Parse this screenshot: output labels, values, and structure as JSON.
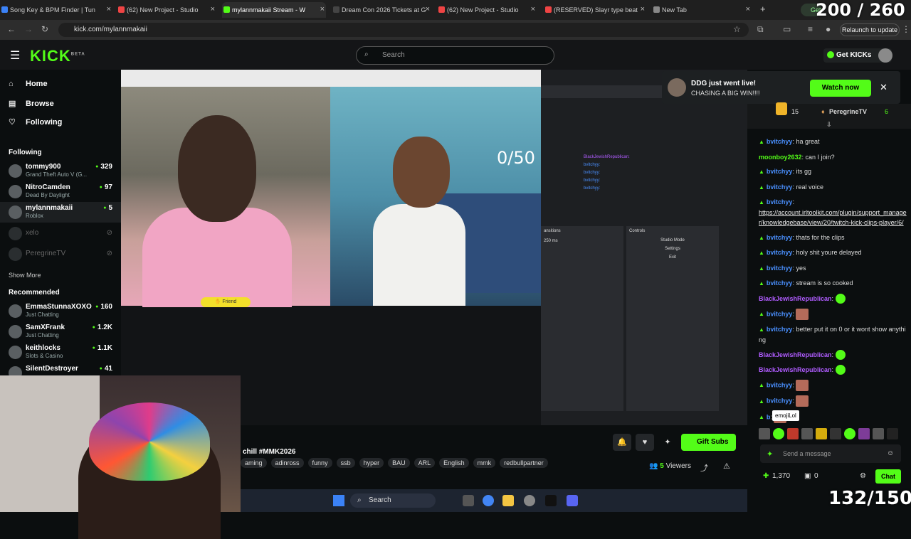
{
  "browser": {
    "tabs": [
      {
        "title": "Song Key & BPM Finder | Tun",
        "color": "#3b82f6"
      },
      {
        "title": "(62) New Project - Studio",
        "color": "#ef4444"
      },
      {
        "title": "mylannmakaii Stream - W",
        "color": "#53fc18",
        "active": true
      },
      {
        "title": "Dream Con 2026 Tickets at G",
        "color": "#444444"
      },
      {
        "title": "(62) New Project - Studio",
        "color": "#ef4444"
      },
      {
        "title": "(RESERVED) Slayr type beat",
        "color": "#ef4444"
      },
      {
        "title": "New Tab",
        "color": "#888888"
      }
    ],
    "url": "kick.com/mylannmakaii",
    "relaunch": "Relaunch to update",
    "getapp": "Get"
  },
  "overlay": {
    "top_counter": "200 / 260",
    "video_counter": "0/50",
    "bottom_counter": "132/150"
  },
  "header": {
    "logo": "KICK",
    "logo_sup": "BETA",
    "search_placeholder": "Search",
    "get_kicks": "Get KICKs"
  },
  "sidebar": {
    "nav": [
      {
        "label": "Home",
        "icon": "⌂"
      },
      {
        "label": "Browse",
        "icon": "▤"
      },
      {
        "label": "Following",
        "icon": "♡"
      }
    ],
    "following_title": "Following",
    "following": [
      {
        "name": "tommy900",
        "category": "Grand Theft Auto V (G...",
        "viewers": "329"
      },
      {
        "name": "NitroCamden",
        "category": "Dead By Daylight",
        "viewers": "97"
      },
      {
        "name": "mylannmakaii",
        "category": "Roblox",
        "viewers": "5",
        "selected": true
      },
      {
        "name": "xelo",
        "category": "",
        "viewers": "",
        "offline": true
      },
      {
        "name": "PeregrineTV",
        "category": "",
        "viewers": "",
        "offline": true
      }
    ],
    "show_more": "Show More",
    "recommended_title": "Recommended",
    "recommended": [
      {
        "name": "EmmaStunnaXOXO",
        "category": "Just Chatting",
        "viewers": "160"
      },
      {
        "name": "SamXFrank",
        "category": "Just Chatting",
        "viewers": "1.2K"
      },
      {
        "name": "keithlocks",
        "category": "Slots & Casino",
        "viewers": "1.1K"
      },
      {
        "name": "SilentDestroyer",
        "category": "",
        "viewers": "41"
      }
    ]
  },
  "notification": {
    "title": "DDG just went live!",
    "subtitle": "CHASING A BIG WIN!!!!",
    "watch": "Watch now"
  },
  "obs": {
    "chat": [
      "BlackJewishRepublican:",
      "bvitchyy:",
      "bvitchyy:",
      "bvitchyy:",
      "bvitchyy:"
    ],
    "transitions": "ansitions",
    "controls": "Controls",
    "studio_mode": "Studio Mode",
    "settings": "Settings",
    "exit": "Exit",
    "duration": "250 ms"
  },
  "stream_info": {
    "title": "chill #MMK2026",
    "tags": [
      "aming",
      "adinross",
      "funny",
      "ssb",
      "hyper",
      "BAU",
      "ARL",
      "English",
      "mmk",
      "redbullpartner"
    ],
    "gift_subs": "Gift Subs",
    "viewers_count": "5",
    "viewers_label": "Viewers"
  },
  "chat": {
    "gifter1": "PeregrineTV",
    "gifter1_count": "6",
    "gifter0_count": "15",
    "messages": [
      {
        "user": "bvitchyy",
        "color": "#4a90ff",
        "text": "ha great",
        "badge": true
      },
      {
        "user": "moonboy2632",
        "color": "#53fc18",
        "text": "can I join?"
      },
      {
        "user": "bvitchyy",
        "color": "#4a90ff",
        "text": "its gg",
        "badge": true
      },
      {
        "user": "bvitchyy",
        "color": "#4a90ff",
        "text": "real voice",
        "badge": true
      },
      {
        "user": "bvitchyy",
        "color": "#4a90ff",
        "text": "",
        "link": "https://account.irltoolkit.com/plugin/support_manager/knowledgebase/view/20/twitch-kick-clips-player/6/",
        "badge": true
      },
      {
        "user": "bvitchyy",
        "color": "#4a90ff",
        "text": "thats for the clips",
        "badge": true
      },
      {
        "user": "bvitchyy",
        "color": "#4a90ff",
        "text": "holy shit youre delayed",
        "badge": true
      },
      {
        "user": "bvitchyy",
        "color": "#4a90ff",
        "text": "yes",
        "badge": true
      },
      {
        "user": "bvitchyy",
        "color": "#4a90ff",
        "text": "stream is so cooked",
        "badge": true
      },
      {
        "user": "BlackJewishRepublican",
        "color": "#b05cff",
        "text": "",
        "emote": "green"
      },
      {
        "user": "bvitchyy",
        "color": "#4a90ff",
        "text": "",
        "emote": "face",
        "badge": true
      },
      {
        "user": "bvitchyy",
        "color": "#4a90ff",
        "text": "better put it on 0 or it wont show anything",
        "badge": true
      },
      {
        "user": "BlackJewishRepublican",
        "color": "#b05cff",
        "text": "",
        "emote": "green"
      },
      {
        "user": "BlackJewishRepublican",
        "color": "#b05cff",
        "text": "",
        "emote": "green"
      },
      {
        "user": "bvitchyy",
        "color": "#4a90ff",
        "text": "",
        "emote": "face",
        "badge": true
      },
      {
        "user": "bvitchyy",
        "color": "#4a90ff",
        "text": "",
        "emote": "face",
        "badge": true
      },
      {
        "user": "b",
        "color": "#4a90ff",
        "text": "",
        "emote": "face",
        "badge": true
      }
    ],
    "tooltip": "emojiLol",
    "input_placeholder": "Send a message",
    "points": "1,370",
    "subs": "0",
    "chat_btn": "Chat"
  },
  "taskbar": {
    "search": "Search"
  },
  "accent": "#53fc18"
}
